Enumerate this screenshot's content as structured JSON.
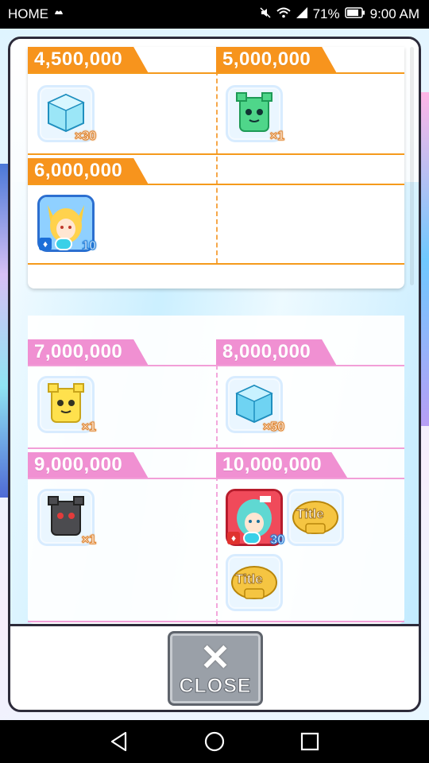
{
  "status_bar": {
    "left_label": "HOME",
    "battery_percent": "71%",
    "time": "9:00 AM"
  },
  "rewards": {
    "orange_section": [
      {
        "threshold": "4,500,000",
        "items": [
          {
            "icon": "blue-cube-icon",
            "qty": "×30"
          }
        ]
      },
      {
        "threshold": "5,000,000",
        "items": [
          {
            "icon": "green-creature-icon",
            "qty": "×1"
          }
        ]
      },
      {
        "threshold": "6,000,000",
        "items": [
          {
            "icon": "fox-girl-character-icon",
            "qty": "10"
          }
        ]
      }
    ],
    "pink_section": [
      {
        "threshold": "7,000,000",
        "items": [
          {
            "icon": "yellow-creature-icon",
            "qty": "×1"
          }
        ]
      },
      {
        "threshold": "8,000,000",
        "items": [
          {
            "icon": "blue-cube-icon",
            "qty": "×50"
          }
        ]
      },
      {
        "threshold": "9,000,000",
        "items": [
          {
            "icon": "black-creature-icon",
            "qty": "×1"
          }
        ]
      },
      {
        "threshold": "10,000,000",
        "items": [
          {
            "icon": "teal-hair-character-icon",
            "qty": "30"
          },
          {
            "icon": "title-badge-icon",
            "label": "Title"
          },
          {
            "icon": "title-badge-icon",
            "label": "Title"
          }
        ]
      }
    ]
  },
  "close_button": {
    "label": "CLOSE"
  },
  "colors": {
    "orange_tier": "#f7941d",
    "pink_tier": "#f090d2",
    "modal_border": "#2d2b3a",
    "close_button": "#9aa0a8"
  }
}
